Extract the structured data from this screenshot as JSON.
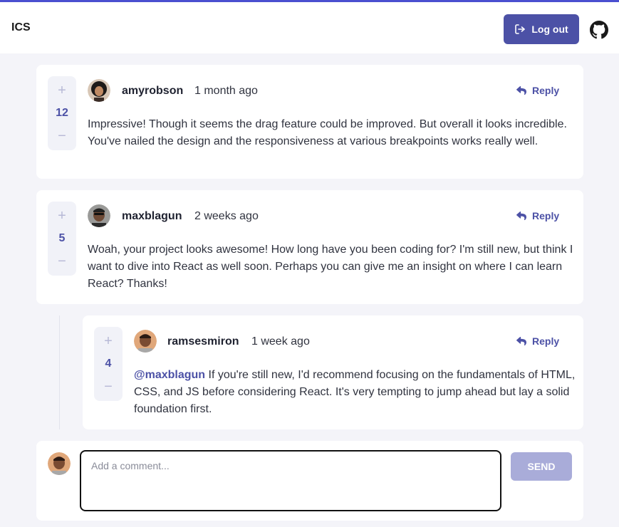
{
  "header": {
    "brand": "ICS",
    "logout_label": "Log out",
    "accent_color": "#4c51a6"
  },
  "comments": [
    {
      "score": "12",
      "username": "amyrobson",
      "time": "1 month ago",
      "reply_label": "Reply",
      "content": "Impressive! Though it seems the drag feature could be improved. But overall it looks incredible. You've nailed the design and the responsiveness at various breakpoints works really well."
    },
    {
      "score": "5",
      "username": "maxblagun",
      "time": "2 weeks ago",
      "reply_label": "Reply",
      "content": "Woah, your project looks awesome! How long have you been coding for? I'm still new, but think I want to dive into React as well soon. Perhaps you can give me an insight on where I can learn React? Thanks!"
    }
  ],
  "replies": [
    {
      "score": "4",
      "username": "ramsesmiron",
      "time": "1 week ago",
      "reply_label": "Reply",
      "mention": "@maxblagun",
      "content": " If you're still new, I'd recommend focusing on the fundamentals of HTML, CSS, and JS before considering React. It's very tempting to jump ahead but lay a solid foundation first."
    }
  ],
  "compose": {
    "placeholder": "Add a comment...",
    "value": "",
    "send_label": "SEND"
  },
  "vote_icons": {
    "plus": "+",
    "minus": "−"
  }
}
